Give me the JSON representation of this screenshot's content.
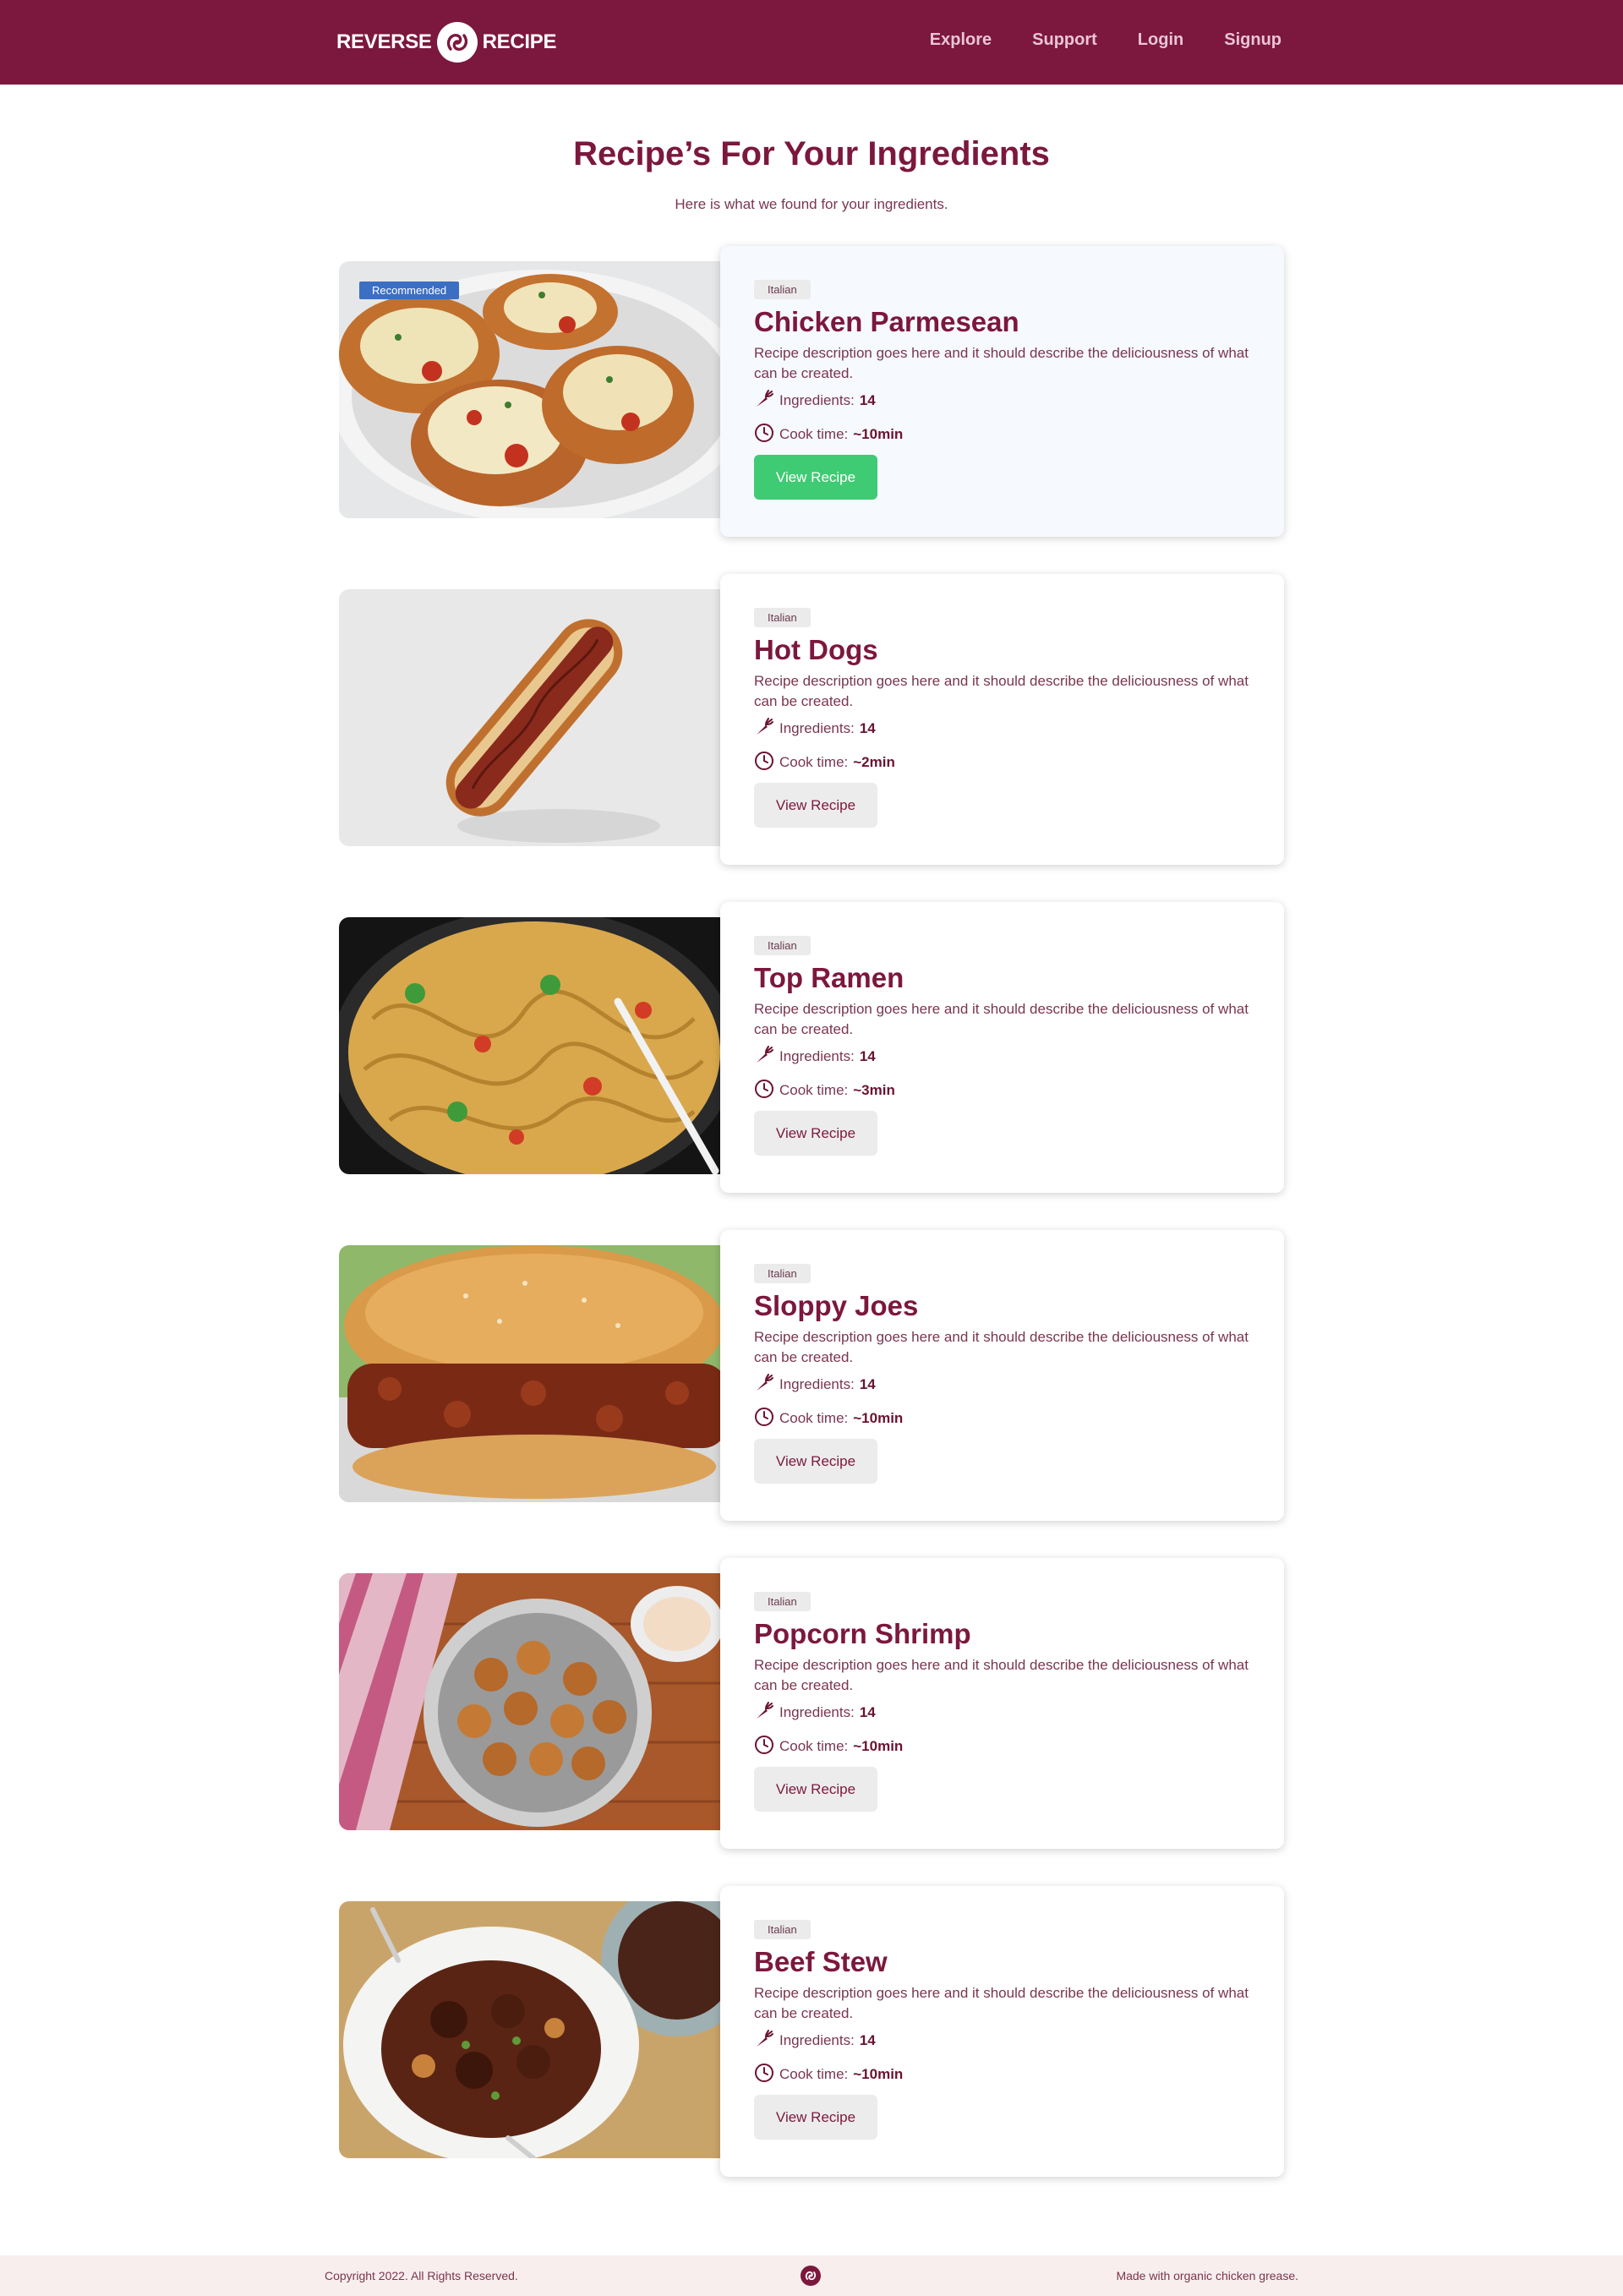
{
  "brand": {
    "word_left": "REVERSE",
    "word_right": "RECIPE",
    "logo_icon": "swirl-logo-icon"
  },
  "nav": {
    "items": [
      "Explore",
      "Support",
      "Login",
      "Signup"
    ]
  },
  "colors": {
    "header_bg": "#7c173d",
    "title": "#7c173d",
    "primary_button": "#3ecb73",
    "badge": "#3b6fc4",
    "footer_bg": "#f9eeee"
  },
  "heading": {
    "title": "Recipe’s For Your Ingredients",
    "subtitle": "Here is what we found for your ingredients."
  },
  "labels": {
    "ingredients": "Ingredients:",
    "cook_time": "Cook time:",
    "view_recipe": "View Recipe",
    "recommended": "Recommended"
  },
  "recipes": [
    {
      "name": "Chicken Parmesean",
      "cuisine": "Italian",
      "description": "Recipe description goes here and it should describe the deliciousness of what can be created.",
      "ingredients": "14",
      "cook_time": "~10min",
      "recommended": true
    },
    {
      "name": "Hot Dogs",
      "cuisine": "Italian",
      "description": "Recipe description goes here and it should describe the deliciousness of what can be created.",
      "ingredients": "14",
      "cook_time": "~2min",
      "recommended": false
    },
    {
      "name": "Top Ramen",
      "cuisine": "Italian",
      "description": "Recipe description goes here and it should describe the deliciousness of what can be created.",
      "ingredients": "14",
      "cook_time": "~3min",
      "recommended": false
    },
    {
      "name": "Sloppy Joes",
      "cuisine": "Italian",
      "description": "Recipe description goes here and it should describe the deliciousness of what can be created.",
      "ingredients": "14",
      "cook_time": "~10min",
      "recommended": false
    },
    {
      "name": "Popcorn Shrimp",
      "cuisine": "Italian",
      "description": "Recipe description goes here and it should describe the deliciousness of what can be created.",
      "ingredients": "14",
      "cook_time": "~10min",
      "recommended": false
    },
    {
      "name": "Beef Stew",
      "cuisine": "Italian",
      "description": "Recipe description goes here and it should describe the deliciousness of what can be created.",
      "ingredients": "14",
      "cook_time": "~10min",
      "recommended": false
    }
  ],
  "footer": {
    "copyright": "Copyright 2022. All Rights Reserved.",
    "tagline": "Made with organic chicken grease."
  }
}
